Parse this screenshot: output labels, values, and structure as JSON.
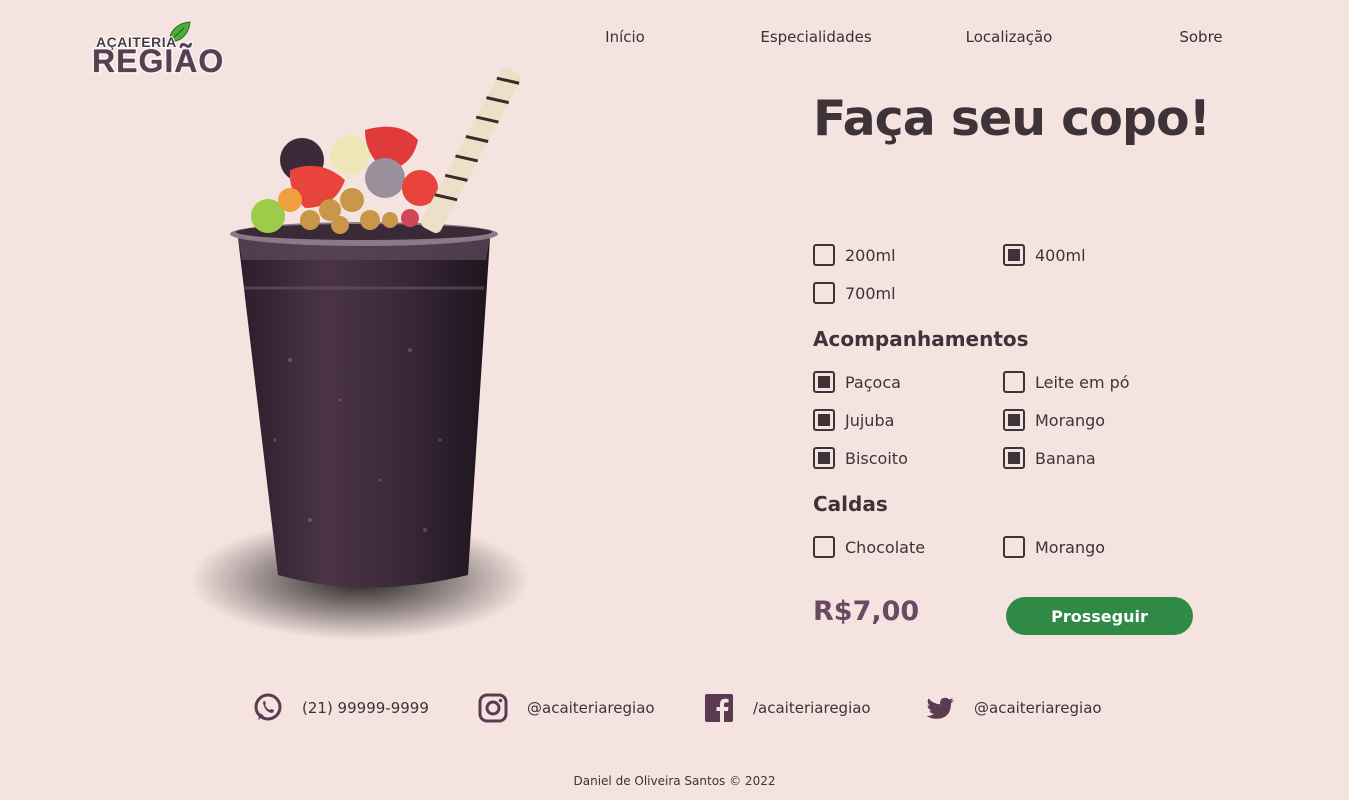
{
  "logo": {
    "top": "AÇAITERIA",
    "main": "REGIÃO"
  },
  "nav": [
    "Início",
    "Especialidades",
    "Localização",
    "Sobre"
  ],
  "title": "Faça seu copo!",
  "sizes": [
    {
      "label": "200ml",
      "checked": false
    },
    {
      "label": "400ml",
      "checked": true
    },
    {
      "label": "700ml",
      "checked": false
    }
  ],
  "toppings_heading": "Acompanhamentos",
  "toppings": [
    {
      "label": "Paçoca",
      "checked": true
    },
    {
      "label": "Leite em pó",
      "checked": false
    },
    {
      "label": "Jujuba",
      "checked": true
    },
    {
      "label": "Morango",
      "checked": true
    },
    {
      "label": "Biscoito",
      "checked": true
    },
    {
      "label": "Banana",
      "checked": true
    }
  ],
  "syrups_heading": "Caldas",
  "syrups": [
    {
      "label": "Chocolate",
      "checked": false
    },
    {
      "label": "Morango",
      "checked": false
    }
  ],
  "price": "R$7,00",
  "proceed_label": "Prosseguir",
  "footer": {
    "whatsapp": "(21) 99999-9999",
    "instagram": "@acaiteriaregiao",
    "facebook": "/acaiteriaregiao",
    "twitter": "@acaiteriaregiao",
    "copyright": "Daniel de Oliveira Santos © 2022"
  },
  "colors": {
    "background": "#f5e3e0",
    "text": "#3d3339",
    "price": "#6a4a62",
    "button": "#2f8a46",
    "icon": "#5b3b52"
  }
}
